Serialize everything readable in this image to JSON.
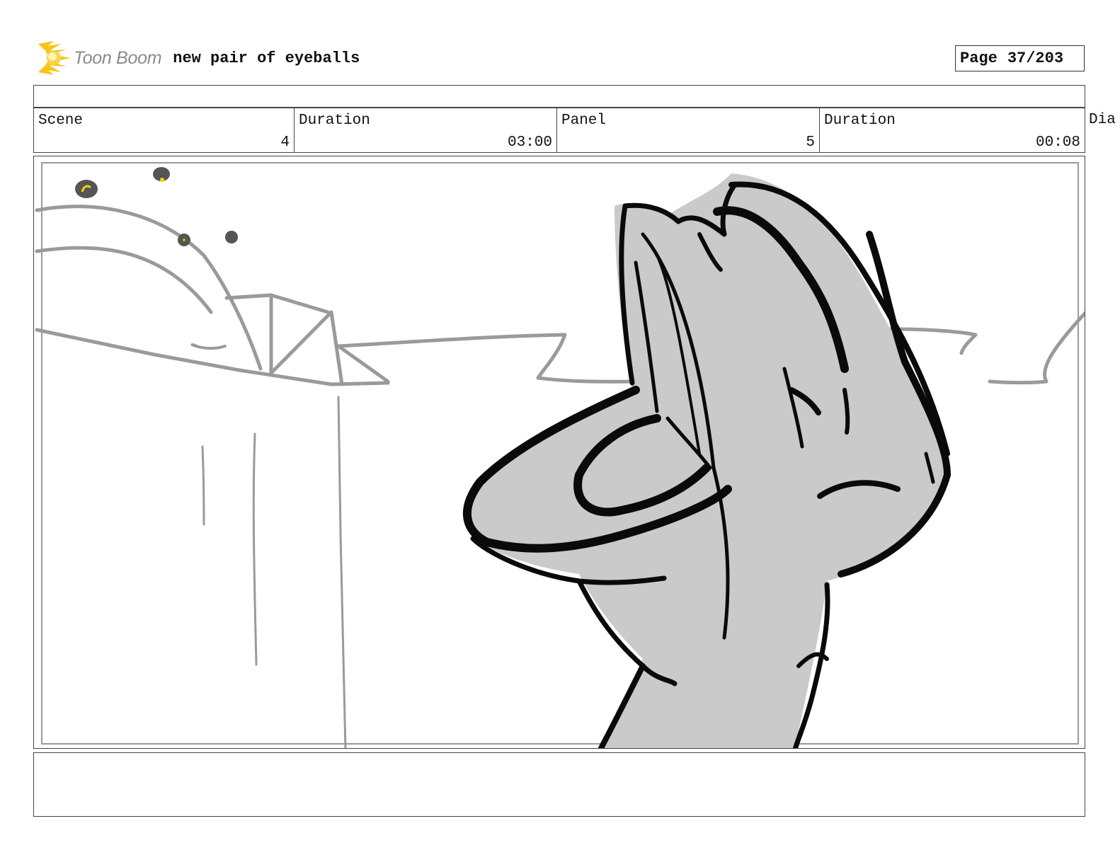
{
  "header": {
    "brand": "Toon Boom",
    "title": "new pair of eyeballs",
    "page_label": "Page",
    "page_value": "37/203"
  },
  "info": {
    "scene_label": "Scene",
    "scene_value": "4",
    "scene_duration_label": "Duration",
    "scene_duration_value": "03:00",
    "panel_label": "Panel",
    "panel_value": "5",
    "panel_duration_label": "Duration",
    "panel_duration_value": "00:08",
    "dialog_label_partial": "Dia"
  },
  "colors": {
    "logo_accent": "#f5c518",
    "sketch_light": "#9a9a9a",
    "sketch_dark": "#0a0a0a",
    "fill_gray": "#cacaca",
    "frame_border": "#444444"
  },
  "icons": {
    "logo": "toon-boom-sunburst-icon"
  }
}
